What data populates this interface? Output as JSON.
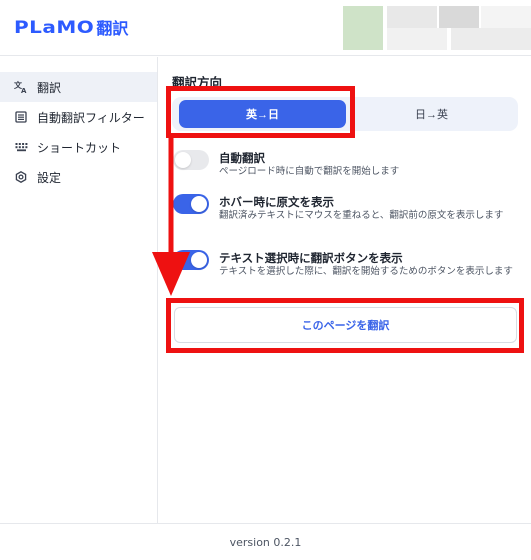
{
  "header": {
    "logo_text": "PLaMO",
    "logo_suffix": "翻訳"
  },
  "sidebar": {
    "items": [
      {
        "label": "翻訳",
        "icon": "translate-icon",
        "active": true
      },
      {
        "label": "自動翻訳フィルター",
        "icon": "filter-list-icon",
        "active": false
      },
      {
        "label": "ショートカット",
        "icon": "keyboard-icon",
        "active": false
      },
      {
        "label": "設定",
        "icon": "settings-gear-icon",
        "active": false
      }
    ]
  },
  "main": {
    "direction_title": "翻訳方向",
    "direction_options": [
      {
        "label": "英→日",
        "selected": true
      },
      {
        "label": "日→英",
        "selected": false
      }
    ],
    "settings": [
      {
        "title": "自動翻訳",
        "description": "ページロード時に自動で翻訳を開始します",
        "enabled": false
      },
      {
        "title": "ホバー時に原文を表示",
        "description": "翻訳済みテキストにマウスを重ねると、翻訳前の原文を表示します",
        "enabled": true
      },
      {
        "title": "テキスト選択時に翻訳ボタンを表示",
        "description": "テキストを選択した際に、翻訳を開始するためのボタンを表示します",
        "enabled": true
      }
    ],
    "translate_page_button": "このページを翻訳"
  },
  "footer": {
    "version": "version 0.2.1"
  },
  "colors": {
    "accent": "#3a64e8",
    "annotation_red": "#ee1111",
    "active_nav_bg": "#eef1f7"
  }
}
